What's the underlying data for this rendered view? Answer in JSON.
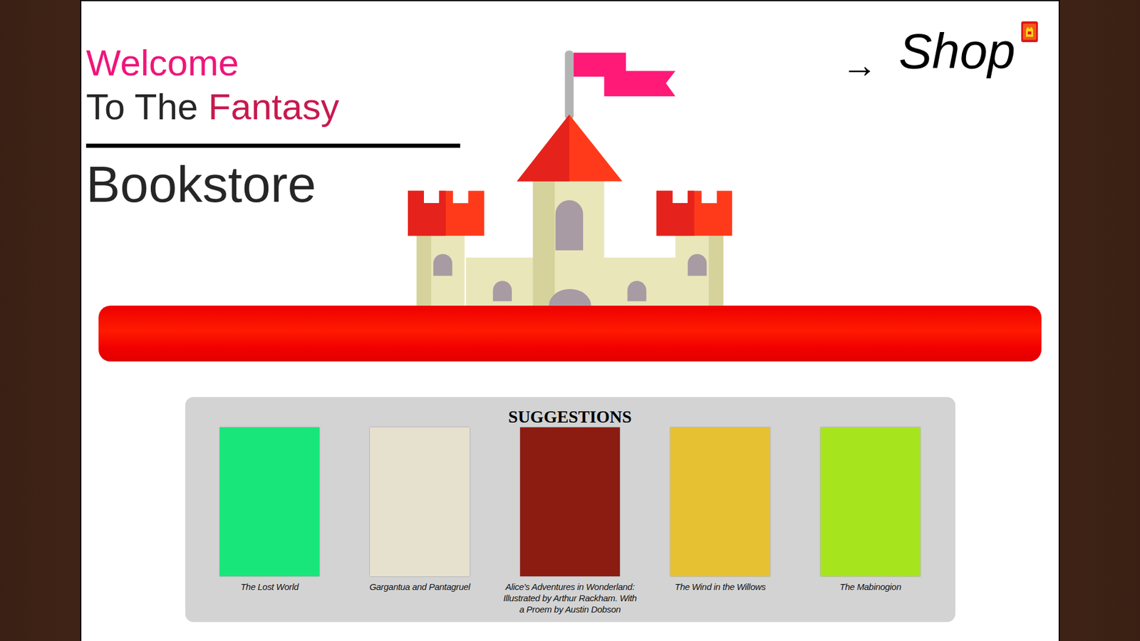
{
  "header": {
    "welcome": "Welcome",
    "line2": "To The",
    "highlight": "Fantasy",
    "bookstore": "Bookstore"
  },
  "shop": {
    "arrow": "→",
    "label": "Shop"
  },
  "suggestions": {
    "heading": "SUGGESTIONS",
    "books": [
      {
        "title": "The Lost World",
        "color": "#19e67a"
      },
      {
        "title": "Gargantua and Pantagruel",
        "color": "#e6e0cf"
      },
      {
        "title": "Alice's Adventures in Wonderland: Illustrated by Arthur Rackham. With a Proem by Austin Dobson",
        "color": "#8c1c12"
      },
      {
        "title": "The Wind in the Willows",
        "color": "#e6c232"
      },
      {
        "title": "The Mabinogion",
        "color": "#a6e51e"
      }
    ]
  }
}
